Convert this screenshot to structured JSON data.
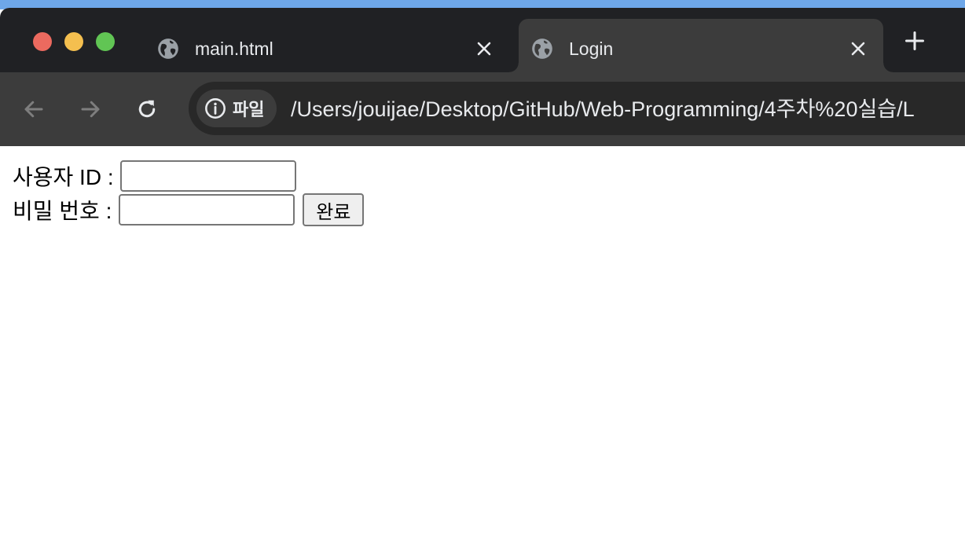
{
  "browser": {
    "tabs": [
      {
        "title": "main.html",
        "icon": "globe-icon",
        "active": false
      },
      {
        "title": "Login",
        "icon": "globe-icon",
        "active": true
      }
    ],
    "address_bar": {
      "site_info_label": "파일",
      "url": "/Users/jouijae/Desktop/GitHub/Web-Programming/4주차%20실습/L"
    },
    "colors": {
      "tabstrip": "#202124",
      "toolbar": "#3c3c3c",
      "close_dot": "#ec6a5f",
      "minimize_dot": "#f4bf4f",
      "maximize_dot": "#61c554"
    }
  },
  "login_form": {
    "user_id_label": "사용자 ID :",
    "user_id_value": "",
    "password_label": "비밀 번호 :",
    "password_value": "",
    "submit_label": "완료"
  }
}
